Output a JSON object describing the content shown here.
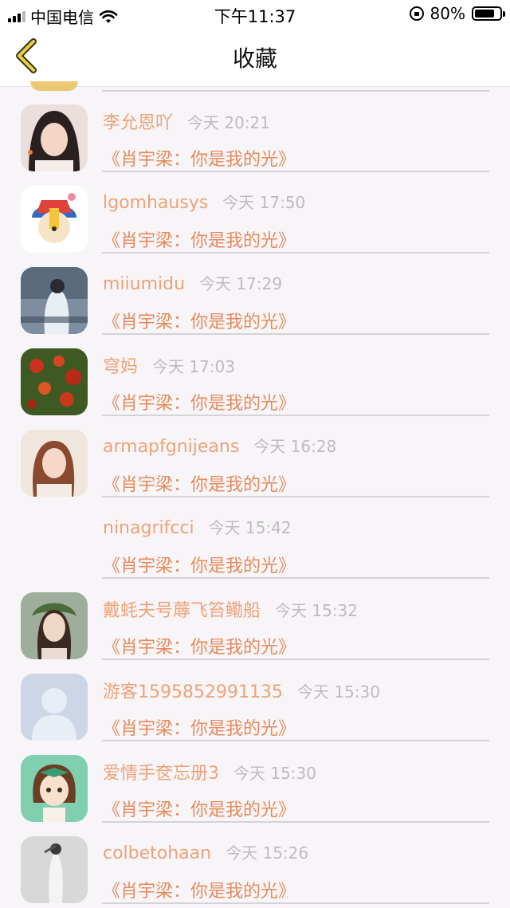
{
  "status_bar": {
    "carrier": "中国电信",
    "time": "下午11:37",
    "battery": "80%",
    "battery_level": 0.8
  },
  "nav": {
    "title": "收藏",
    "back_icon": "chevron-left-icon",
    "accent": "#e8d43a"
  },
  "items": [
    {
      "name": "李允恩吖",
      "time": "今天 20:21",
      "title": "《肖宇梁：你是我的光》",
      "avatar_color": "#3a3a3a"
    },
    {
      "name": "lgomhausys",
      "time": "今天 17:50",
      "title": "《肖宇梁：你是我的光》",
      "avatar_color": "#e04b3a"
    },
    {
      "name": "miiumidu",
      "time": "今天 17:29",
      "title": "《肖宇梁：你是我的光》",
      "avatar_color": "#5a6a80"
    },
    {
      "name": "穹妈",
      "time": "今天 17:03",
      "title": "《肖宇梁：你是我的光》",
      "avatar_color": "#8a3a20"
    },
    {
      "name": "armapfgnijeans",
      "time": "今天 16:28",
      "title": "《肖宇梁：你是我的光》",
      "avatar_color": "#d9b8a0"
    },
    {
      "name": "ninagrifcci",
      "time": "今天 15:42",
      "title": "《肖宇梁：你是我的光》",
      "avatar_color": ""
    },
    {
      "name": "戴蚝夫号蓐飞笞鳓船",
      "time": "今天 15:32",
      "title": "《肖宇梁：你是我的光》",
      "avatar_color": "#6a8070"
    },
    {
      "name": "游客1595852991135",
      "time": "今天 15:30",
      "title": "《肖宇梁：你是我的光》",
      "avatar_color": "#cdd6e6"
    },
    {
      "name": "爱情手奁忘册3",
      "time": "今天 15:30",
      "title": "《肖宇梁：你是我的光》",
      "avatar_color": "#7fcfb0"
    },
    {
      "name": "colbetohaan",
      "time": "今天 15:26",
      "title": "《肖宇梁：你是我的光》",
      "avatar_color": "#bdbdbd"
    }
  ]
}
